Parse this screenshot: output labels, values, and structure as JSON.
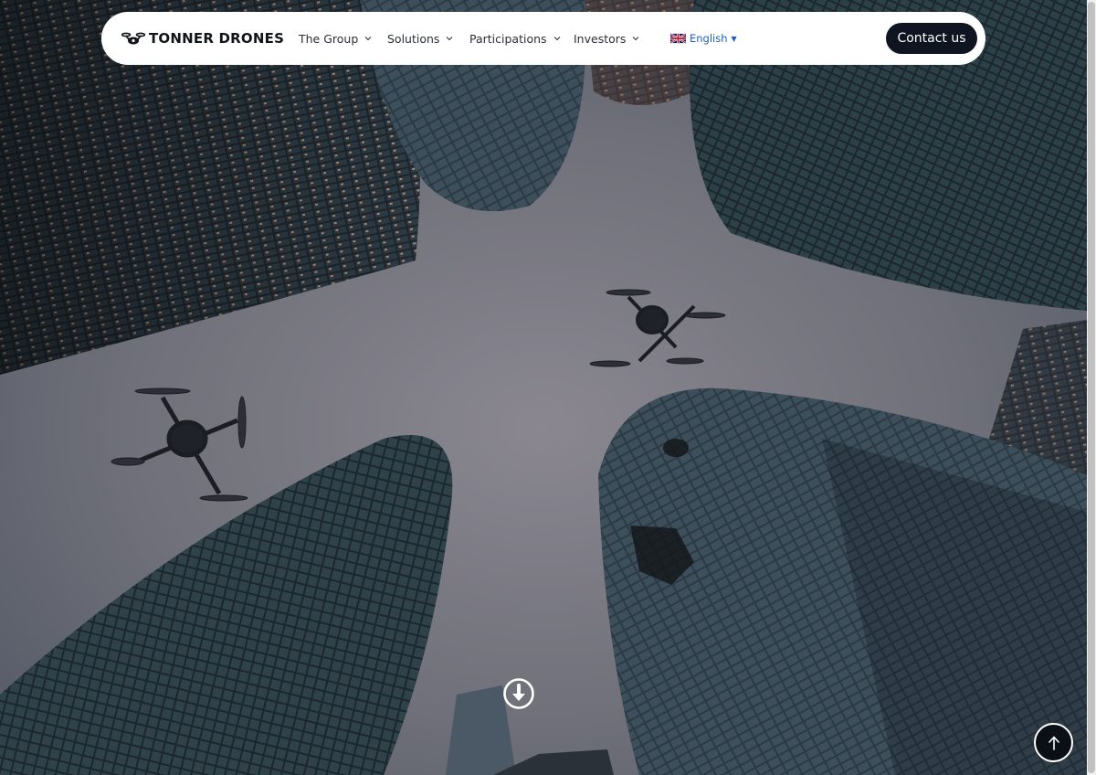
{
  "brand": {
    "name": "TONNER DRONES",
    "logo_icon": "drone-logo-icon"
  },
  "nav": {
    "items": [
      {
        "label": "The Group",
        "icon": "chevron-down-icon"
      },
      {
        "label": "Solutions",
        "icon": "chevron-down-icon"
      },
      {
        "label": "Participations",
        "icon": "chevron-down-icon"
      },
      {
        "label": "Investors",
        "icon": "chevron-down-icon"
      }
    ],
    "language": {
      "label": "English",
      "flag": "uk-flag-icon",
      "caret": "▼"
    },
    "cta": "Contact us"
  },
  "hero": {
    "scroll_icon": "arrow-down-circle-icon"
  },
  "back_to_top": {
    "icon": "arrow-up-icon"
  },
  "colors": {
    "nav_bg": "#ffffff",
    "cta_bg": "#0e1520",
    "language_link": "#1d5fbf",
    "sky": "#6e6f79"
  }
}
